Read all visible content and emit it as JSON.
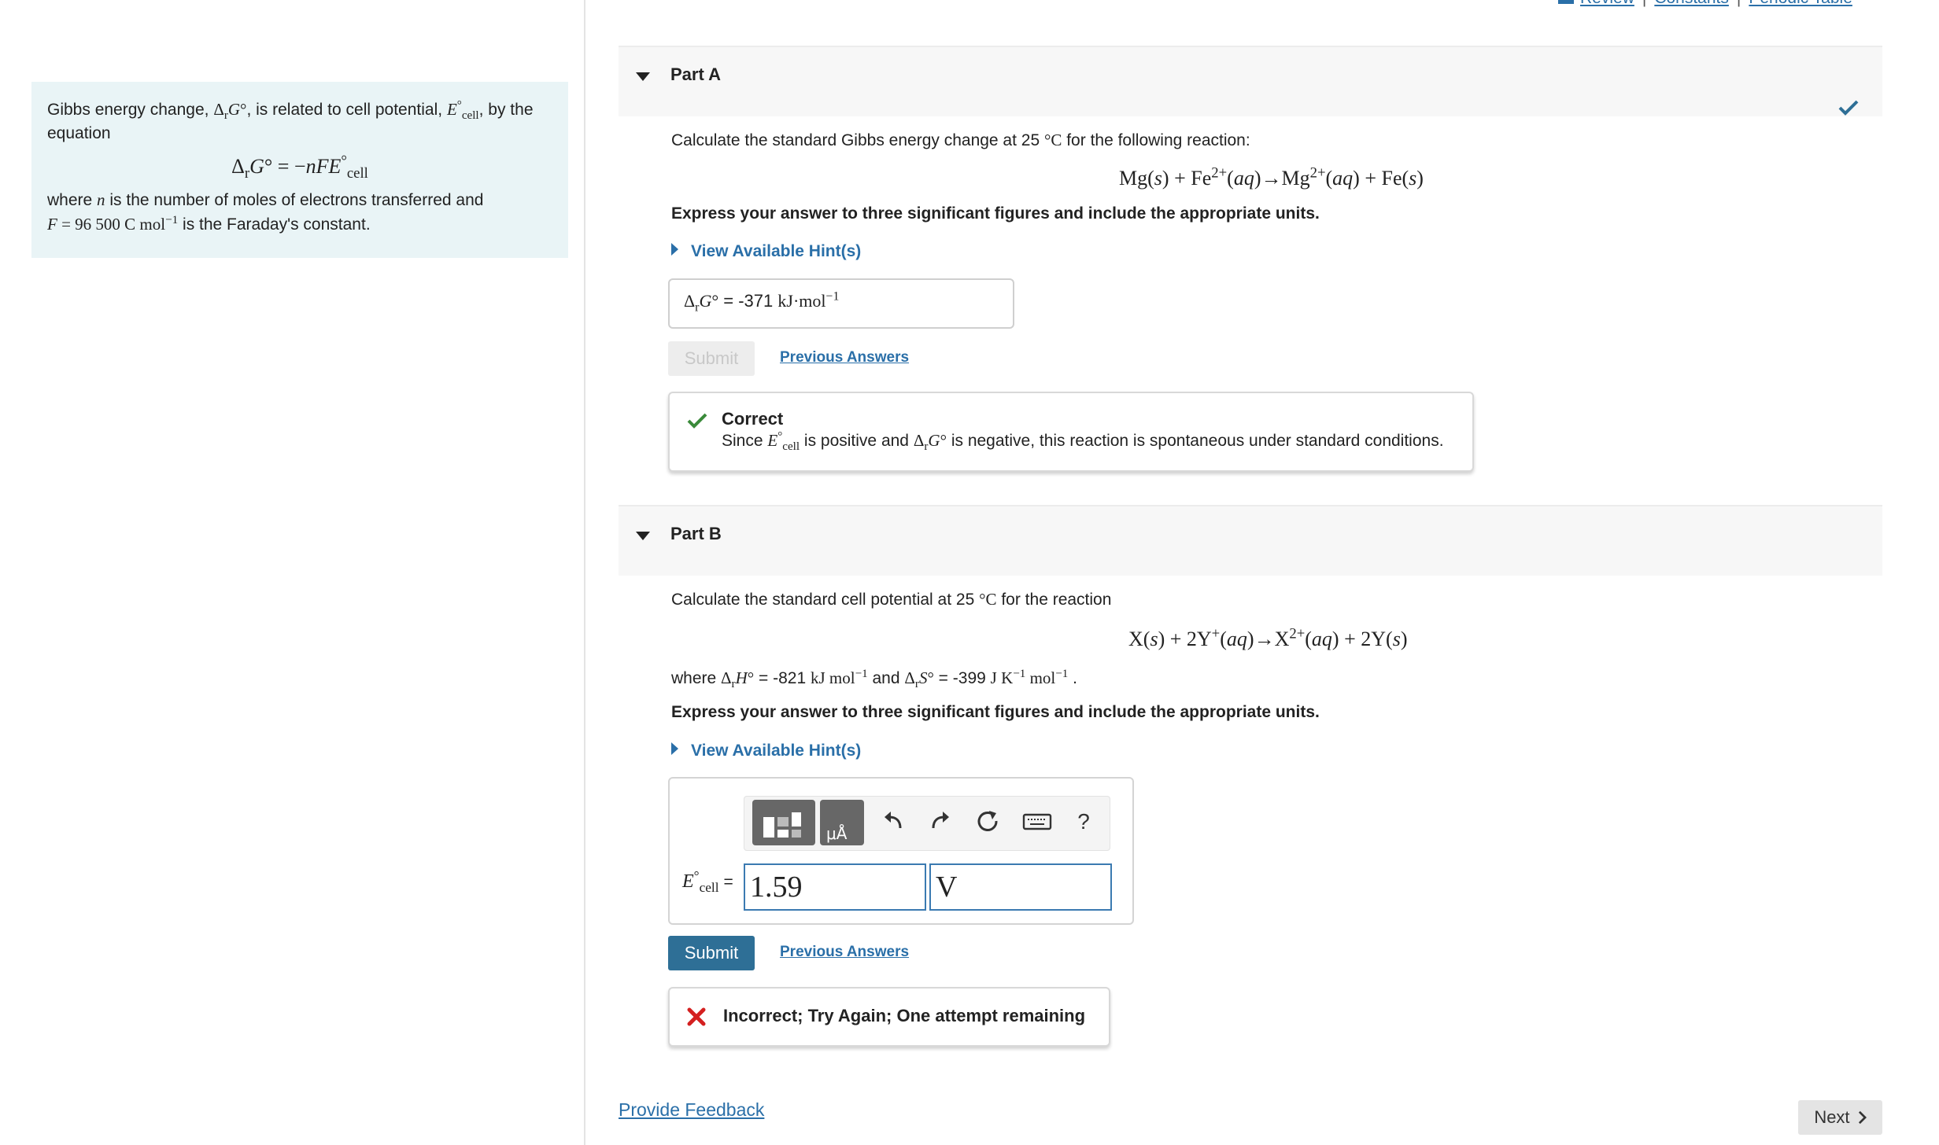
{
  "header": {
    "links": [
      "Review",
      "Constants",
      "Periodic Table"
    ]
  },
  "info_panel": {
    "intro_1": "Gibbs energy change, ",
    "intro_2": ", is related to cell potential, ",
    "intro_3": ", by the equation",
    "where_1": "where ",
    "where_2": " is the number of moles of electrons transferred and",
    "faraday_value": "96 500 C mol",
    "faraday_text": " is the Faraday's constant."
  },
  "part_a": {
    "title": "Part A",
    "question_1": "Calculate the standard Gibbs energy change at 25 ",
    "question_unit": "°C",
    "question_2": " for the following reaction:",
    "instruction": "Express your answer to three significant figures and include the appropriate units.",
    "hint_label": "View Available Hint(s)",
    "answer_value": "-371",
    "answer_unit": "kJ·mol",
    "submit_label": "Submit",
    "previous_answers_label": "Previous Answers",
    "feedback_title": "Correct",
    "feedback_1": "Since ",
    "feedback_2": " is positive and ",
    "feedback_3": " is negative, this reaction is spontaneous under standard conditions."
  },
  "part_b": {
    "title": "Part B",
    "question_1": "Calculate the standard cell potential at 25 ",
    "question_unit": "°C",
    "question_2": " for the reaction",
    "where_1": "where ",
    "dh_value": "-821",
    "and_text": " and ",
    "ds_value": "-399",
    "instruction": "Express your answer to three significant figures and include the appropriate units.",
    "hint_label": "View Available Hint(s)",
    "value_input": "1.59",
    "unit_input": "V",
    "toolbar_help": "?",
    "submit_label": "Submit",
    "previous_answers_label": "Previous Answers",
    "feedback_title": "Incorrect; Try Again; One attempt remaining"
  },
  "footer": {
    "provide_feedback": "Provide Feedback",
    "next_label": "Next"
  },
  "colors": {
    "link": "#2a6fa8",
    "info_bg": "#e9f4f6",
    "correct": "#3a8a3a",
    "incorrect": "#d42020",
    "submit_active": "#2e6f96"
  }
}
